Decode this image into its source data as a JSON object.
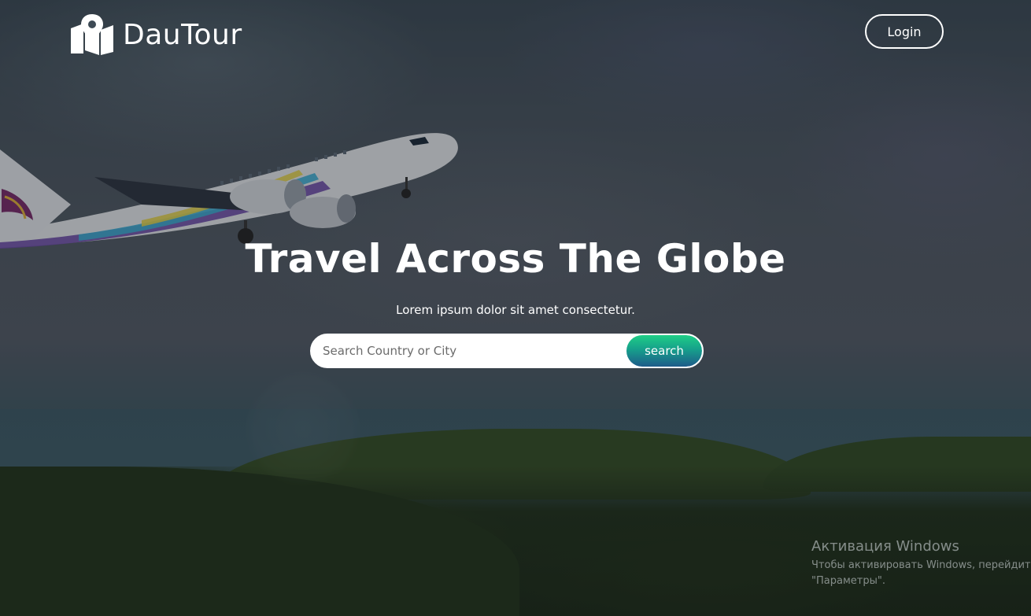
{
  "brand": {
    "name": "DauTour",
    "logo_icon": "map-pin-icon"
  },
  "nav": {
    "login_label": "Login"
  },
  "hero": {
    "title": "Travel Across The Globe",
    "subtitle": "Lorem ipsum dolor sit amet consectetur."
  },
  "search": {
    "placeholder": "Search Country or City",
    "value": "",
    "button_label": "search"
  },
  "windows_watermark": {
    "title": "Активация Windows",
    "line1": "Чтобы активировать Windows, перейдит",
    "line2": "\"Параметры\"."
  },
  "colors": {
    "search_button_top": "#1fce86",
    "search_button_bottom": "#1e5b8a",
    "text": "#ffffff"
  }
}
